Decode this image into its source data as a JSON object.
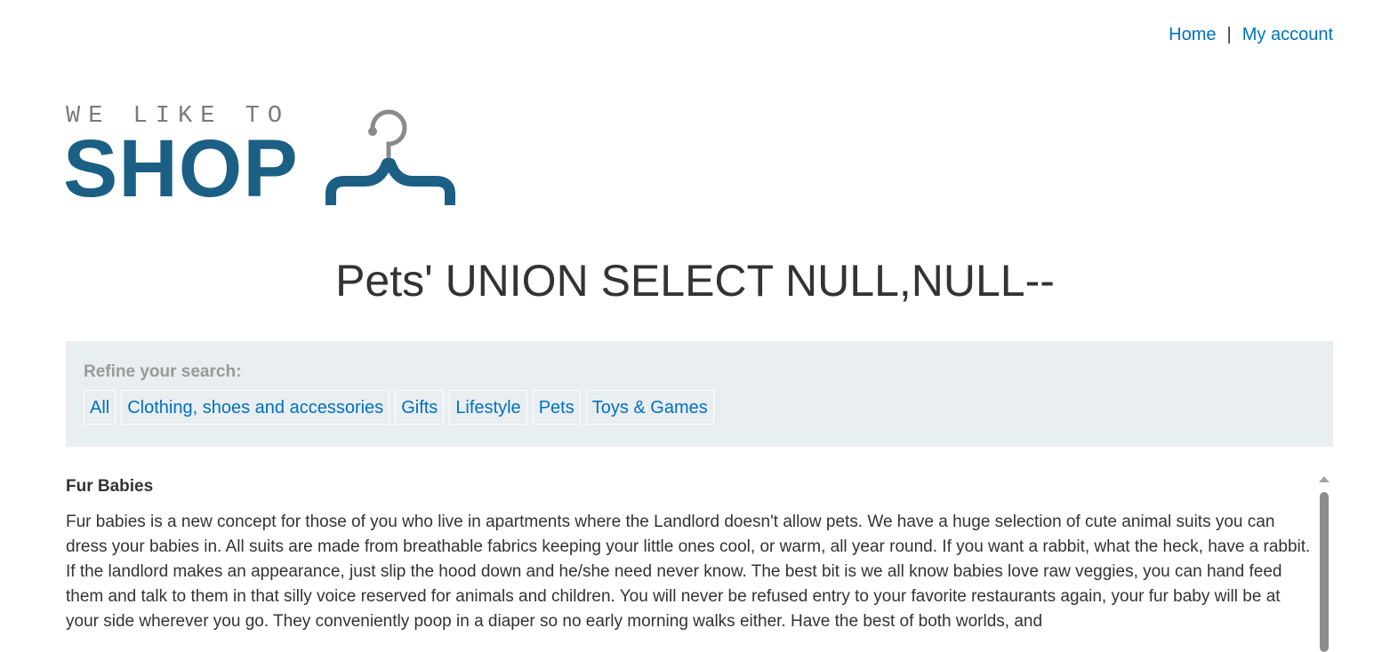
{
  "nav": {
    "home_label": "Home",
    "separator": "|",
    "account_label": "My account"
  },
  "logo": {
    "tagline": "WE LIKE TO",
    "wordmark": "SHOP",
    "icon": "hanger-icon"
  },
  "page": {
    "title": "Pets' UNION SELECT NULL,NULL--"
  },
  "filters": {
    "label": "Refine your search:",
    "items": [
      {
        "label": "All"
      },
      {
        "label": "Clothing, shoes and accessories"
      },
      {
        "label": "Gifts"
      },
      {
        "label": "Lifestyle"
      },
      {
        "label": "Pets"
      },
      {
        "label": "Toys & Games"
      }
    ]
  },
  "product": {
    "name": "Fur Babies",
    "description": "Fur babies is a new concept for those of you who live in apartments where the Landlord doesn't allow pets. We have a huge selection of cute animal suits you can dress your babies in. All suits are made from breathable fabrics keeping your little ones cool, or warm, all year round. If you want a rabbit, what the heck, have a rabbit. If the landlord makes an appearance, just slip the hood down and he/she need never know. The best bit is we all know babies love raw veggies, you can hand feed them and talk to them in that silly voice reserved for animals and children. You will never be refused entry to your favorite restaurants again, your fur baby will be at your side wherever you go. They conveniently poop in a diaper so no early morning walks either. Have the best of both worlds, and "
  },
  "colors": {
    "link": "#0071bc",
    "brand": "#1b5f85",
    "panel_bg": "#e9eef1",
    "text": "#333333"
  }
}
